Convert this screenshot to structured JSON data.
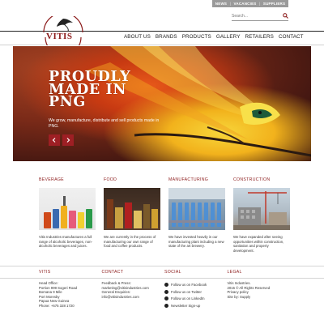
{
  "util_nav": {
    "items": [
      "NEWS",
      "VACANCIES",
      "SUPPLIERS"
    ],
    "separator": "|"
  },
  "search": {
    "placeholder": "Search..."
  },
  "logo": {
    "text": "VITIS"
  },
  "main_nav": {
    "items": [
      "ABOUT US",
      "BRANDS",
      "PRODUCTS",
      "GALLERY",
      "RETAILERS",
      "CONTACT"
    ]
  },
  "hero": {
    "title_lines": [
      "PROUDLY",
      "MADE IN",
      "PNG"
    ],
    "subtitle": "We grow, manufacture, distribute and sell products made in PNG."
  },
  "categories": [
    {
      "title": "BEVERAGE",
      "text": "Vitis Industries manufactures a full range of alcoholic beverages, non-alcoholic beverages and juices."
    },
    {
      "title": "FOOD",
      "text": "We are currently in the process of manufacturing our own range of food and coffee products."
    },
    {
      "title": "MANUFACTURING",
      "text": "We have invested heavily in our manufacturing plant including a new state of the art brewery."
    },
    {
      "title": "CONSTRUCTION",
      "text": "We have expanded after seeing opportunities within construction, sanitation and property development."
    }
  ],
  "footer": {
    "vitis": {
      "title": "VITIS",
      "lines": [
        "Head Office:",
        "Portion 999 Sogeri Road",
        "Bomana 9 Mile",
        "Port Moresby",
        "Papua New Guinea",
        "Phone: +675 328 1720"
      ]
    },
    "contact": {
      "title": "CONTACT",
      "lines": [
        "Feedback & Press:",
        "marketing@vitisindustries.com",
        "General Enquiries:",
        "info@vitisindustries.com"
      ]
    },
    "social": {
      "title": "SOCIAL",
      "items": [
        "Follow us on Facebook",
        "Follow us on Twitter",
        "Follow us on LinkedIn",
        "Newsletter Sign-up"
      ]
    },
    "legal": {
      "title": "LEGAL",
      "lines": [
        "Vitis Industries.",
        "2015 © All Rights Reserved",
        "Privacy policy",
        "Site by: Supply"
      ]
    }
  },
  "colors": {
    "brand_red": "#8b1a1a",
    "arrow_red": "#9e1f24",
    "util_bar_gray": "#9a9a9a"
  }
}
